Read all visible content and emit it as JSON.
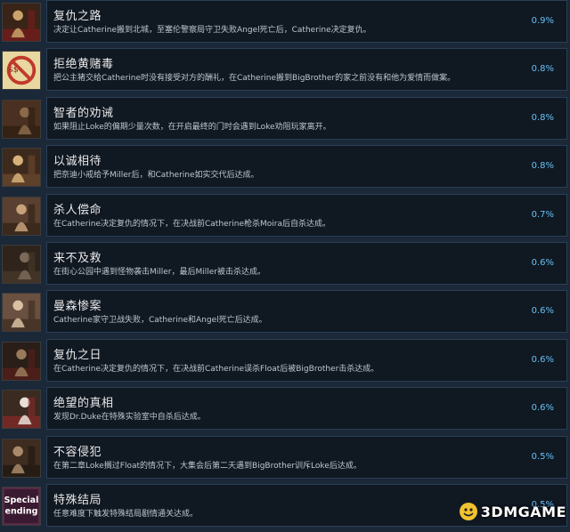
{
  "achievements": [
    {
      "title": "复仇之路",
      "desc": "决定让Catherine搬到北城，至塞伦警察局守卫失败Angel死亡后，Catherine决定复仇。",
      "percent": "0.9%",
      "icon": "woman-portrait-icon",
      "palette": [
        "#3a2418",
        "#c9a36a",
        "#7a1c1c"
      ]
    },
    {
      "title": "拒绝黄赌毒",
      "desc": "把公主猪交给Catherine时没有接受对方的酬礼，在Catherine搬到BigBrother的家之前没有和他为爱情而做案。",
      "percent": "0.8%",
      "icon": "no-sign-icon",
      "palette": [
        "#e8d7a0",
        "#c0392b",
        "#3a2a18"
      ]
    },
    {
      "title": "智者的劝诫",
      "desc": "如果阻止Loke的偏期少量次数，在开启最终的门时会遇到Loke劝阻玩家离开。",
      "percent": "0.8%",
      "icon": "man-portrait-icon",
      "palette": [
        "#4a3020",
        "#8b6a4a",
        "#2b1c10"
      ]
    },
    {
      "title": "以诚相待",
      "desc": "把奈迪小戒给予Miller后，和Catherine如实交代后达成。",
      "percent": "0.8%",
      "icon": "group-portrait-icon",
      "palette": [
        "#3d2a1c",
        "#d6b27a",
        "#6e4a2e"
      ]
    },
    {
      "title": "杀人偿命",
      "desc": "在Catherine决定复仇的情况下，在决战前Catherine枪杀Moira后自杀达成。",
      "percent": "0.7%",
      "icon": "couple-portrait-icon",
      "palette": [
        "#5a4030",
        "#c8a27a",
        "#2e1f14"
      ]
    },
    {
      "title": "来不及救",
      "desc": "在街心公园中遇到怪物袭击Miller，最后Miller被击杀达成。",
      "percent": "0.6%",
      "icon": "fallen-figure-icon",
      "palette": [
        "#2e241c",
        "#7b6a5a",
        "#4a3a2a"
      ]
    },
    {
      "title": "曼森惨案",
      "desc": "Catherine家守卫战失败，Catherine和Angel死亡后达成。",
      "percent": "0.6%",
      "icon": "bodies-icon",
      "palette": [
        "#6a5040",
        "#d8c0a0",
        "#3a2a1e"
      ]
    },
    {
      "title": "复仇之日",
      "desc": "在Catherine决定复仇的情况下，在决战前Catherine误杀Float后被BigBrother击杀达成。",
      "percent": "0.6%",
      "icon": "gunman-icon",
      "palette": [
        "#2a1e18",
        "#9a7a5a",
        "#5a1e1a"
      ]
    },
    {
      "title": "绝望的真相",
      "desc": "发现Dr.Duke在特殊实验室中自杀后达成。",
      "percent": "0.6%",
      "icon": "lab-scene-icon",
      "palette": [
        "#3a2a20",
        "#e8e0d8",
        "#8a2a2a"
      ]
    },
    {
      "title": "不容侵犯",
      "desc": "在第二章Loke搁过Float的情况下，大集会后第二天遇到BigBrother训斥Loke后达成。",
      "percent": "0.5%",
      "icon": "confrontation-icon",
      "palette": [
        "#3e2c20",
        "#a88a6a",
        "#1e1610"
      ]
    },
    {
      "title": "特殊结局",
      "desc": "任意难度下触发特殊结局剧情通关达成。",
      "percent": "0.5%",
      "icon": "special-ending-icon",
      "palette": [
        "#d86aa0",
        "#ffffff",
        "#5a2a4a"
      ],
      "icon_text": [
        "Special",
        "ending"
      ]
    }
  ],
  "watermark": {
    "text": "3DMGAME"
  }
}
